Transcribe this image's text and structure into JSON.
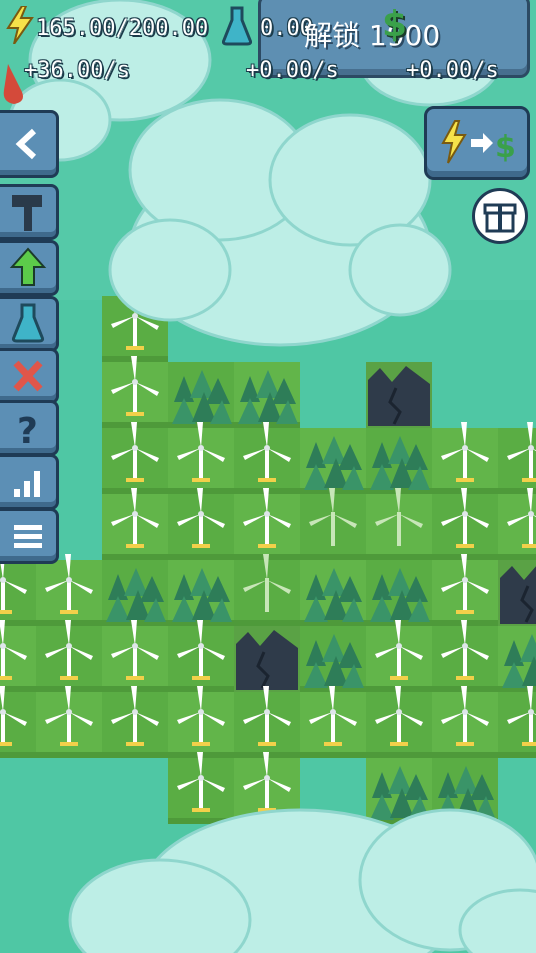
{
  "hud": {
    "energy_value": "165.00/200.00",
    "energy_rate": "+36.00/s",
    "research_value": "0.00",
    "research_rate": "+0.00/s",
    "money_rate": "+0.00/s",
    "unlock_label": "解锁 1900"
  },
  "colors": {
    "grass": "#62b54a",
    "grass_dark": "#4e9a3a",
    "cloud": "#bdeee6",
    "cloud_shade": "#8fd6cd",
    "rock": "#2f3b4a",
    "sky": "#4fc7a4"
  },
  "icons": {
    "energy": "lightning-icon",
    "research": "flask-icon",
    "money": "dollar-icon",
    "back": "chevron-left-icon",
    "build": "hammer-icon",
    "upgrade": "up-arrow-icon",
    "research_tab": "flask-icon",
    "remove": "close-icon",
    "help": "question-icon",
    "stats": "bar-chart-icon",
    "menu": "menu-icon",
    "convert": "energy-to-money-icon",
    "gift": "gift-icon"
  }
}
